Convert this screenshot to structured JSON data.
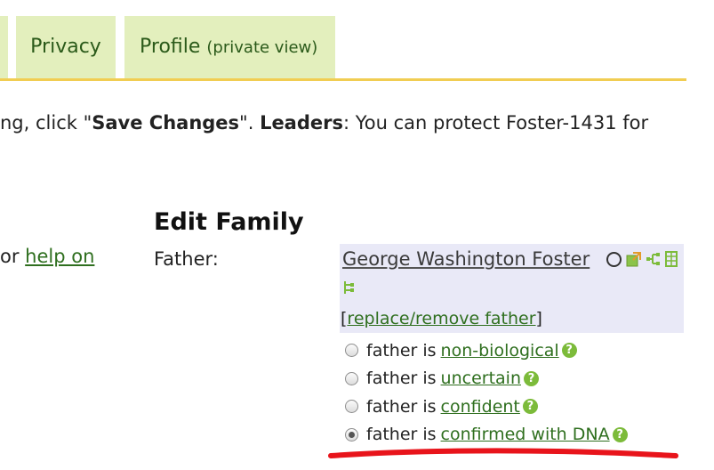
{
  "tabs": {
    "privacy": "Privacy",
    "profile": "Profile",
    "profile_sub": "(private view)"
  },
  "notice": {
    "part1": "ng, click \"",
    "save_changes": "Save Changes",
    "part2": "\". ",
    "leaders": "Leaders",
    "part3": ": You can protect Foster-1431 for"
  },
  "help": {
    "prefix": "or ",
    "link": "help on"
  },
  "edit_family": {
    "title": "Edit Family",
    "father_label": "Father:",
    "father_name": "George Washington Foster",
    "replace_open": "[",
    "replace_link": "replace/remove father",
    "replace_close": "]"
  },
  "status_options": [
    {
      "prefix": "father is",
      "link": "non-biological",
      "checked": false
    },
    {
      "prefix": "father is",
      "link": "uncertain",
      "checked": false
    },
    {
      "prefix": "father is",
      "link": "confident",
      "checked": false
    },
    {
      "prefix": "father is",
      "link": "confirmed with DNA",
      "checked": true
    }
  ],
  "help_glyph": "?",
  "colors": {
    "tab_bg": "#e3efbd",
    "tab_rule": "#f1cd52",
    "link": "#2f6f1f",
    "father_box": "#e9e9f7",
    "help_icon": "#7cbb3a",
    "annotation_red": "#e8141b"
  }
}
